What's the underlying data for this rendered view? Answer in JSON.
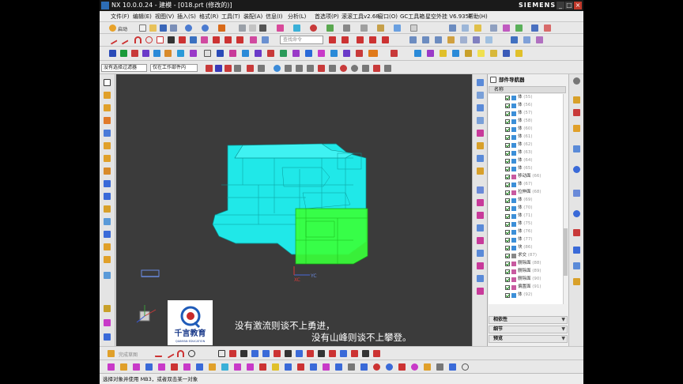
{
  "window": {
    "title": "NX 10.0.0.24 - 建模 - [018.prt  (修改的)]",
    "brand": "SIEMENS",
    "minimize": "_",
    "restore": "□",
    "close": "×"
  },
  "menu": {
    "items": [
      "文件(F)",
      "编辑(E)",
      "视图(V)",
      "插入(S)",
      "格式(R)",
      "工具(T)",
      "装配(A)",
      "信息(I)",
      "分析(L)",
      "首选项(P)",
      "滚滚工具v2.68",
      "窗口(O)",
      "GC工具箱",
      "星空外挂 V6.935F",
      "帮助(H)"
    ]
  },
  "toolbar1": {
    "start_label": "启动"
  },
  "toolbar2": {
    "search_placeholder": "查找命令"
  },
  "selection_bar": {
    "filter_value": "没有选择过滤器",
    "scope_value": "仅在工作部件内"
  },
  "navigator": {
    "title": "部件导航器",
    "column_name": "名称",
    "rows": [
      {
        "label": "体",
        "num": "(55)"
      },
      {
        "label": "体",
        "num": "(56)"
      },
      {
        "label": "体",
        "num": "(57)"
      },
      {
        "label": "体",
        "num": "(58)"
      },
      {
        "label": "体",
        "num": "(60)"
      },
      {
        "label": "体",
        "num": "(61)"
      },
      {
        "label": "体",
        "num": "(62)"
      },
      {
        "label": "体",
        "num": "(63)"
      },
      {
        "label": "体",
        "num": "(64)"
      },
      {
        "label": "体",
        "num": "(65)"
      },
      {
        "label": "移动面",
        "num": "(66)"
      },
      {
        "label": "体",
        "num": "(67)"
      },
      {
        "label": "拉伸面",
        "num": "(68)"
      },
      {
        "label": "体",
        "num": "(69)"
      },
      {
        "label": "体",
        "num": "(70)"
      },
      {
        "label": "体",
        "num": "(71)"
      },
      {
        "label": "体",
        "num": "(75)"
      },
      {
        "label": "体",
        "num": "(76)"
      },
      {
        "label": "体",
        "num": "(77)"
      },
      {
        "label": "块",
        "num": "(86)"
      },
      {
        "label": "求交",
        "num": "(87)"
      },
      {
        "label": "删除面",
        "num": "(88)"
      },
      {
        "label": "删除面",
        "num": "(89)"
      },
      {
        "label": "删除面",
        "num": "(90)"
      },
      {
        "label": "偏置面",
        "num": "(91)"
      },
      {
        "label": "体",
        "num": "(92)"
      }
    ],
    "panels": [
      "相依性",
      "细节",
      "预览"
    ]
  },
  "bottom_toolbar": {
    "label": "完成草图"
  },
  "status": {
    "text": "选择对象并使用 MB3，或者双击某一对象"
  },
  "viewport": {
    "axis_x": "XC",
    "axis_y": "YC",
    "model_color_main": "#20e8e8",
    "model_color_highlight": "#39ff39"
  },
  "overlay": {
    "logo_title": "千言教育",
    "logo_sub": "QIANYAN EDUCATION",
    "caption_line1": "没有激流则谈不上勇进，",
    "caption_line2": "没有山峰则谈不上攀登。"
  }
}
